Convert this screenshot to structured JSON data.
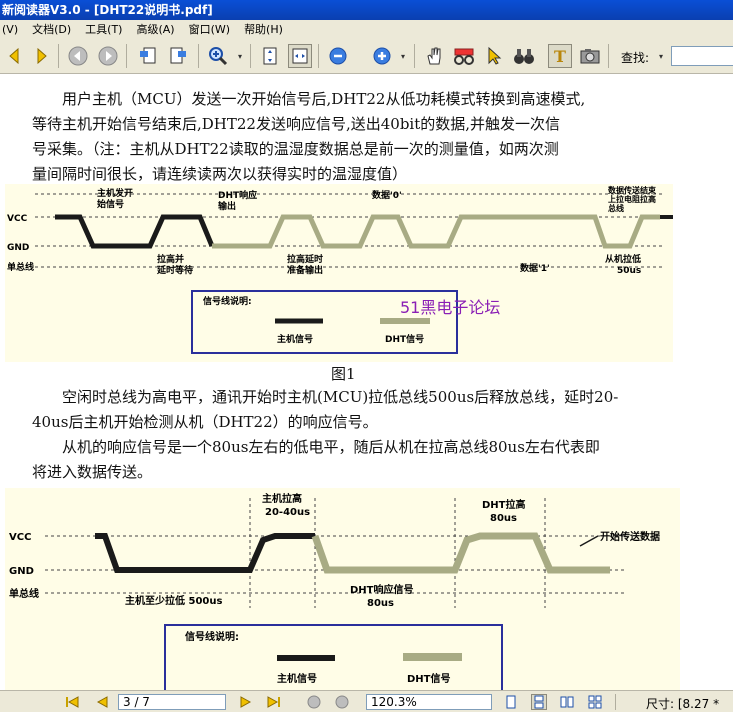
{
  "window": {
    "title": "新阅读器V3.0 - [DHT22说明书.pdf]"
  },
  "menu": [
    "(V)",
    "文档(D)",
    "工具(T)",
    "高级(A)",
    "窗口(W)",
    "帮助(H)"
  ],
  "toolbar": {
    "find_label": "查找:",
    "find_value": "",
    "dropdown_arrow": "▾"
  },
  "doc": {
    "paragraphs": [
      "　　用户主机（MCU）发送一次开始信号后,DHT22从低功耗模式转换到高速模式,",
      "等待主机开始信号结束后,DHT22发送响应信号,送出40bit的数据,并触发一次信",
      "号采集。（注：主机从DHT22读取的温湿度数据总是前一次的测量值，如两次测",
      "量间隔时间很长，请连续读两次以获得实时的温湿度值）"
    ],
    "figure1": {
      "vcc": "VCC",
      "gnd": "GND",
      "bus": "单总线",
      "top_host_start": [
        "主机发开",
        "始信号"
      ],
      "top_dht_resp": [
        "DHT响应",
        "输出"
      ],
      "top_data0": "数据'0'",
      "top_end": [
        "数据传送结束",
        "上拉电阻拉高",
        "总线"
      ],
      "bot_pullup": [
        "拉高并",
        "延时等待"
      ],
      "bot_pullup2": [
        "拉高延时",
        "准备输出"
      ],
      "bot_data1": "数据'1'",
      "bot_slave": [
        "从机拉低",
        "50us"
      ],
      "legend_title": "信号线说明:",
      "legend_host": "主机信号",
      "legend_dht": "DHT信号",
      "watermark": "51黑电子论坛"
    },
    "caption1": "图1",
    "paragraphs2": [
      "　　空闲时总线为高电平，通讯开始时主机(MCU)拉低总线500us后释放总线，延时20-",
      "40us后主机开始检测从机（DHT22）的响应信号。",
      "　　从机的响应信号是一个80us左右的低电平，随后从机在拉高总线80us左右代表即",
      "将进入数据传送。"
    ],
    "figure2": {
      "vcc": "VCC",
      "gnd": "GND",
      "bus": "单总线",
      "top_host_pull": [
        "主机拉高",
        "20-40us"
      ],
      "top_dht_pull": [
        "DHT拉高",
        "80us"
      ],
      "start_data": "开始传送数据",
      "bot_host_low": "主机至少拉低 500us",
      "bot_dht_resp": [
        "DHT响应信号",
        "80us"
      ],
      "legend_title": "信号线说明:",
      "legend_host": "主机信号",
      "legend_dht": "DHT信号"
    }
  },
  "status": {
    "page": "3 / 7",
    "zoom": "120.3%",
    "size": "尺寸: [8.27 *"
  },
  "colors": {
    "host_line": "#1a1a1a",
    "dht_line": "#a8ab84",
    "diagram_bg": "#fffde7",
    "legend_border": "#2a2f9c",
    "watermark": "#8a1fb5"
  }
}
